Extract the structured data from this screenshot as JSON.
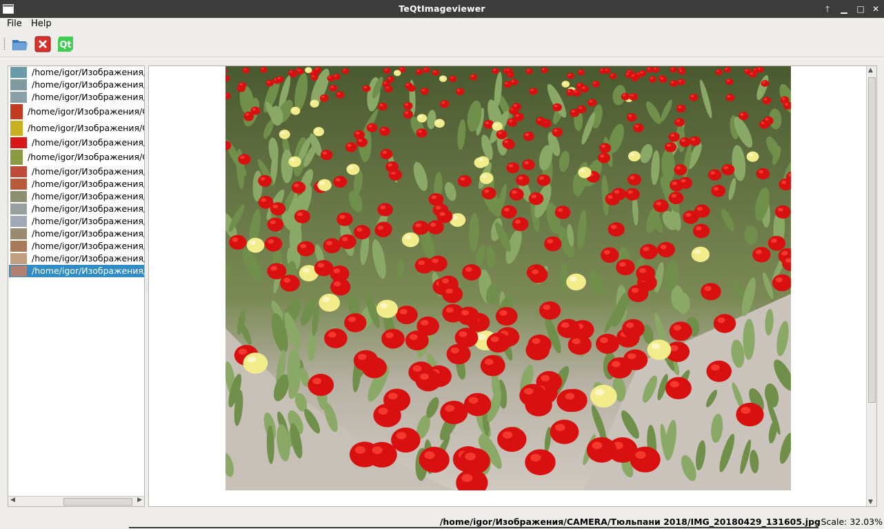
{
  "window": {
    "title": "TeQtImageviewer"
  },
  "menu": {
    "file": "File",
    "help": "Help"
  },
  "toolbar": {
    "open_icon": "folder-open-icon",
    "close_icon": "close-red-x-icon",
    "about_qt_icon": "qt-logo-icon",
    "qt_text": "Qt"
  },
  "file_list": {
    "items": [
      {
        "label": "/home/igor/Изображения/C"
      },
      {
        "label": "/home/igor/Изображения/C"
      },
      {
        "label": "/home/igor/Изображения/C"
      },
      {
        "label": "/home/igor/Изображения/CA"
      },
      {
        "label": "/home/igor/Изображения/CA"
      },
      {
        "label": "/home/igor/Изображения/C"
      },
      {
        "label": "/home/igor/Изображения/CA"
      },
      {
        "label": "/home/igor/Изображения/C"
      },
      {
        "label": "/home/igor/Изображения/C"
      },
      {
        "label": "/home/igor/Изображения/C"
      },
      {
        "label": "/home/igor/Изображения/C"
      },
      {
        "label": "/home/igor/Изображения/C"
      },
      {
        "label": "/home/igor/Изображения/C"
      },
      {
        "label": "/home/igor/Изображения/C"
      },
      {
        "label": "/home/igor/Изображения/C"
      },
      {
        "label": "/home/igor/Изображения/C"
      }
    ],
    "selected_index": 15
  },
  "status": {
    "path": "/home/igor/Изображения/CAMERA/Тюльпани 2018/IMG_20180429_131605.jpg",
    "scale": "Scale: 32.03%"
  },
  "colors": {
    "titlebar": "#3c3c3c",
    "selection": "#308cc6",
    "tulip_red": "#d81010",
    "tulip_yellow": "#f3ec8a",
    "soil": "#c9c3bb"
  }
}
